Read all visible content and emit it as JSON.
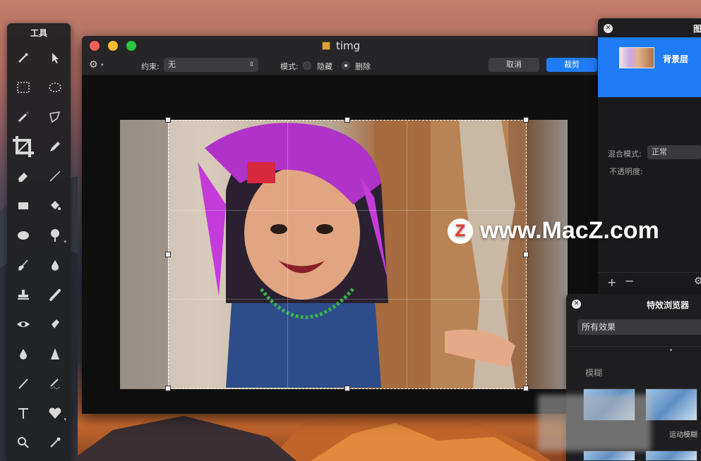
{
  "tools_panel": {
    "title": "工具",
    "tools": [
      {
        "name": "magic-wand-icon",
        "glyph": "✶"
      },
      {
        "name": "move-arrow-icon",
        "glyph": "➤"
      },
      {
        "name": "rect-select-icon",
        "glyph": "⬚"
      },
      {
        "name": "ellipse-select-icon",
        "glyph": "◯"
      },
      {
        "name": "brush-select-icon",
        "glyph": "✎"
      },
      {
        "name": "lasso-icon",
        "glyph": "⌇"
      },
      {
        "name": "crop-icon",
        "glyph": "⛶"
      },
      {
        "name": "pen-icon",
        "glyph": "✒"
      },
      {
        "name": "eraser-icon",
        "glyph": "⬗"
      },
      {
        "name": "line-icon",
        "glyph": "╱"
      },
      {
        "name": "rectangle-shape-icon",
        "glyph": "■"
      },
      {
        "name": "paint-bucket-icon",
        "glyph": "⛽"
      },
      {
        "name": "ellipse-shape-icon",
        "glyph": "⬬"
      },
      {
        "name": "lollipop-gradient-icon",
        "glyph": "⚲"
      },
      {
        "name": "broom-icon",
        "glyph": "⌐"
      },
      {
        "name": "drop-icon",
        "glyph": "💧"
      },
      {
        "name": "stamp-icon",
        "glyph": "⚒"
      },
      {
        "name": "smudge-icon",
        "glyph": "╲"
      },
      {
        "name": "eye-icon",
        "glyph": "◉"
      },
      {
        "name": "sharpen-icon",
        "glyph": "◆"
      },
      {
        "name": "blur-drop-icon",
        "glyph": "●"
      },
      {
        "name": "triangle-icon",
        "glyph": "▲"
      },
      {
        "name": "pencil-icon",
        "glyph": "✏"
      },
      {
        "name": "heal-icon",
        "glyph": "∿"
      },
      {
        "name": "text-icon",
        "glyph": "T"
      },
      {
        "name": "heart-shape-icon",
        "glyph": "♥"
      },
      {
        "name": "zoom-icon",
        "glyph": "⚲"
      },
      {
        "name": "eyedropper-icon",
        "glyph": "⁄"
      }
    ]
  },
  "window": {
    "title": "timg",
    "toolbar": {
      "constraint_label": "约束:",
      "constraint_value": "无",
      "mode_label": "模式:",
      "mode_hide": "隐藏",
      "mode_delete": "删除",
      "cancel": "取消",
      "crop": "裁剪"
    }
  },
  "layers_panel": {
    "title": "图",
    "layer_name": "背景层",
    "blend_label": "混合模式:",
    "blend_value": "正常",
    "opacity_label": "不透明度:",
    "add": "+",
    "remove": "−"
  },
  "effects_panel": {
    "title": "特效浏览器",
    "filter_value": "所有效果",
    "category": "模糊",
    "effect_2_label": "运动模糊"
  },
  "watermark": {
    "logo_letter": "Z",
    "text": "www.MacZ.com"
  },
  "colors": {
    "accent": "#1f7cf5",
    "close": "#fc5f57",
    "minimize": "#fdbc2e",
    "zoom": "#28c840"
  }
}
